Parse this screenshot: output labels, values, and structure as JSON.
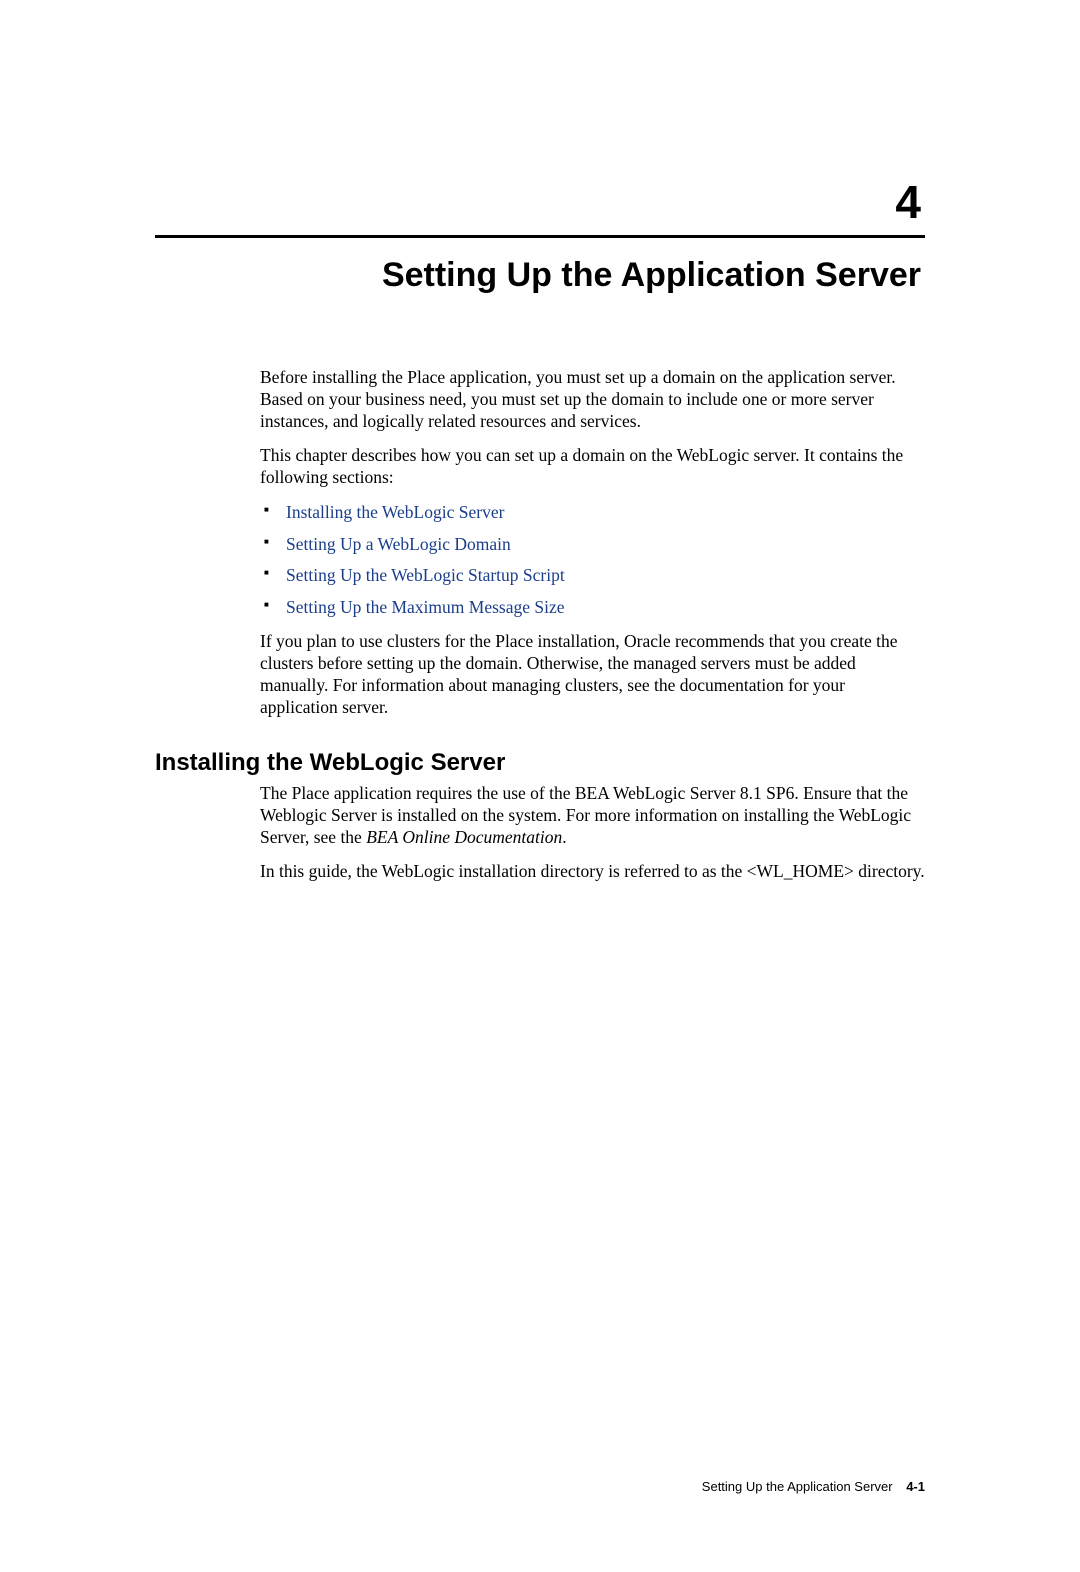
{
  "chapter": {
    "number": "4",
    "title": "Setting Up the Application Server"
  },
  "intro": {
    "p1": "Before installing the Place application, you must set up a domain on the application server. Based on your business need, you must set up the domain to include one or more server instances, and logically related resources and services.",
    "p2": "This chapter describes how you can set up a domain on the WebLogic server. It contains the following sections:",
    "links": [
      "Installing the WebLogic Server",
      "Setting Up a WebLogic Domain",
      "Setting Up the WebLogic Startup Script",
      "Setting Up the Maximum Message Size"
    ],
    "p3": "If you plan to use clusters for the Place installation, Oracle recommends that you create the clusters before setting up the domain. Otherwise, the managed servers must be added manually. For information about managing clusters, see the documentation for your application server."
  },
  "section1": {
    "heading": "Installing the WebLogic Server",
    "p1a": "The Place application requires the use of the BEA WebLogic Server 8.1 SP6. Ensure that the Weblogic Server is installed on the system. For more information on installing the WebLogic Server, see the ",
    "p1b": "BEA Online Documentation",
    "p1c": ".",
    "p2": "In this guide, the WebLogic installation directory is referred to as the <WL_HOME> directory."
  },
  "footer": {
    "title": "Setting Up the Application Server",
    "page": "4-1"
  }
}
